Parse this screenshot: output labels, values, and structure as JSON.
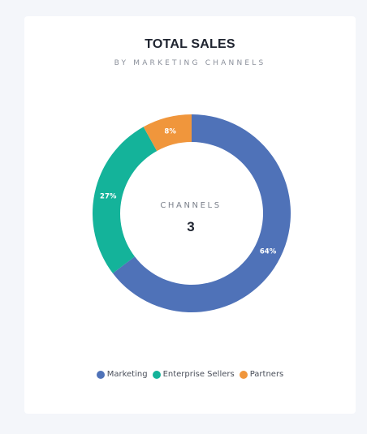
{
  "chart_data": {
    "type": "pie",
    "title": "TOTAL SALES",
    "subtitle": "BY MARKETING CHANNELS",
    "center_label": "CHANNELS",
    "center_value": "3",
    "categories": [
      "Marketing",
      "Enterprise Sellers",
      "Partners"
    ],
    "values": [
      64,
      27,
      8
    ],
    "labels": [
      "64%",
      "27%",
      "8%"
    ],
    "colors": [
      "#4f72b8",
      "#14b39a",
      "#f0963c"
    ],
    "legend_position": "bottom"
  }
}
